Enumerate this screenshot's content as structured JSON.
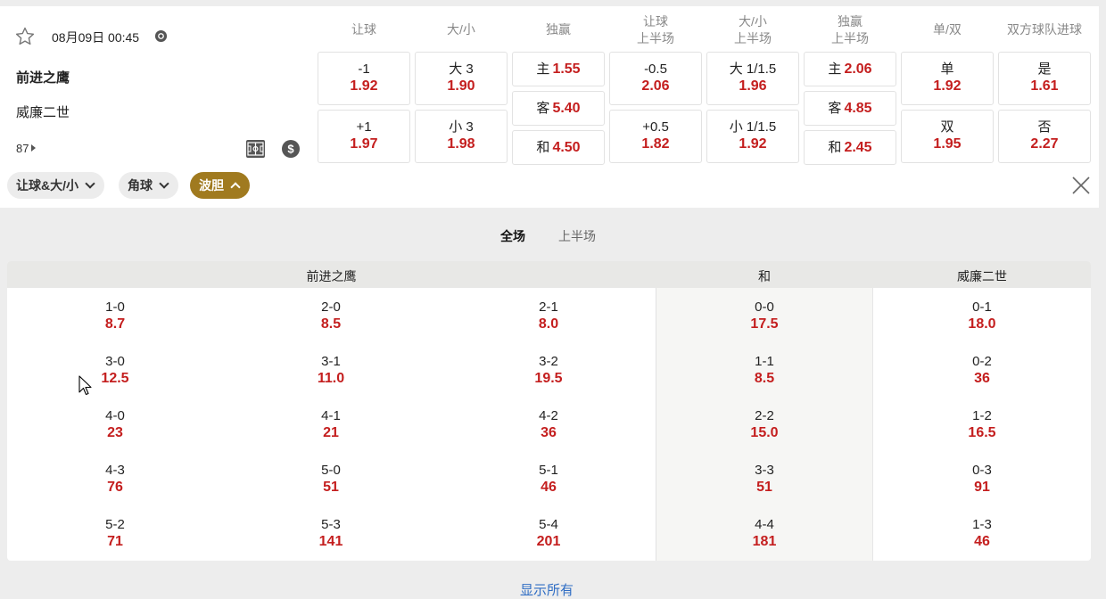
{
  "match": {
    "datetime": "08月09日 00:45",
    "home_team": "前进之鹰",
    "away_team": "威廉二世",
    "more_count": "87"
  },
  "columns": [
    {
      "l1": "让球",
      "l2": ""
    },
    {
      "l1": "大/小",
      "l2": ""
    },
    {
      "l1": "独赢",
      "l2": ""
    },
    {
      "l1": "让球",
      "l2": "上半场"
    },
    {
      "l1": "大/小",
      "l2": "上半场"
    },
    {
      "l1": "独赢",
      "l2": "上半场"
    },
    {
      "l1": "单/双",
      "l2": ""
    },
    {
      "l1": "双方球队进球",
      "l2": ""
    }
  ],
  "odds": {
    "handicap": [
      {
        "label": "-1",
        "odd": "1.92"
      },
      {
        "label": "+1",
        "odd": "1.97"
      }
    ],
    "over_under": [
      {
        "label": "大 3",
        "odd": "1.90"
      },
      {
        "label": "小 3",
        "odd": "1.98"
      }
    ],
    "moneyline": [
      {
        "label": "主",
        "odd": "1.55"
      },
      {
        "label": "客",
        "odd": "5.40"
      },
      {
        "label": "和",
        "odd": "4.50"
      }
    ],
    "handicap_1h": [
      {
        "label": "-0.5",
        "odd": "2.06"
      },
      {
        "label": "+0.5",
        "odd": "1.82"
      }
    ],
    "over_under_1h": [
      {
        "label": "大 1/1.5",
        "odd": "1.96"
      },
      {
        "label": "小 1/1.5",
        "odd": "1.92"
      }
    ],
    "moneyline_1h": [
      {
        "label": "主",
        "odd": "2.06"
      },
      {
        "label": "客",
        "odd": "4.85"
      },
      {
        "label": "和",
        "odd": "2.45"
      }
    ],
    "odd_even": [
      {
        "label": "单",
        "odd": "1.92"
      },
      {
        "label": "双",
        "odd": "1.95"
      }
    ],
    "both_score": [
      {
        "label": "是",
        "odd": "1.61"
      },
      {
        "label": "否",
        "odd": "2.27"
      }
    ]
  },
  "filters": [
    {
      "label": "让球&大/小",
      "active": false
    },
    {
      "label": "角球",
      "active": false
    },
    {
      "label": "波胆",
      "active": true
    }
  ],
  "period_tabs": [
    {
      "label": "全场",
      "active": true
    },
    {
      "label": "上半场",
      "active": false
    }
  ],
  "correct_score": {
    "headers": {
      "home": "前进之鹰",
      "draw": "和",
      "away": "威廉二世"
    },
    "home": [
      [
        {
          "s": "1-0",
          "o": "8.7"
        },
        {
          "s": "2-0",
          "o": "8.5"
        },
        {
          "s": "2-1",
          "o": "8.0"
        }
      ],
      [
        {
          "s": "3-0",
          "o": "12.5"
        },
        {
          "s": "3-1",
          "o": "11.0"
        },
        {
          "s": "3-2",
          "o": "19.5"
        }
      ],
      [
        {
          "s": "4-0",
          "o": "23"
        },
        {
          "s": "4-1",
          "o": "21"
        },
        {
          "s": "4-2",
          "o": "36"
        }
      ],
      [
        {
          "s": "4-3",
          "o": "76"
        },
        {
          "s": "5-0",
          "o": "51"
        },
        {
          "s": "5-1",
          "o": "46"
        }
      ],
      [
        {
          "s": "5-2",
          "o": "71"
        },
        {
          "s": "5-3",
          "o": "141"
        },
        {
          "s": "5-4",
          "o": "201"
        }
      ]
    ],
    "draw": [
      {
        "s": "0-0",
        "o": "17.5"
      },
      {
        "s": "1-1",
        "o": "8.5"
      },
      {
        "s": "2-2",
        "o": "15.0"
      },
      {
        "s": "3-3",
        "o": "51"
      },
      {
        "s": "4-4",
        "o": "181"
      }
    ],
    "away": [
      {
        "s": "0-1",
        "o": "18.0"
      },
      {
        "s": "0-2",
        "o": "36"
      },
      {
        "s": "1-2",
        "o": "16.5"
      },
      {
        "s": "0-3",
        "o": "91"
      },
      {
        "s": "1-3",
        "o": "46"
      }
    ]
  },
  "show_all": "显示所有",
  "icons": [
    "star-icon",
    "live-icon",
    "chevron-right-icon",
    "pitch-icon",
    "dollar-icon",
    "chevron-down-icon",
    "chevron-up-icon",
    "close-icon",
    "mouse-cursor-icon"
  ],
  "colors": {
    "odds_red": "#c41e1e",
    "active_filter": "#a07a1f",
    "link_blue": "#2f6dc4"
  }
}
